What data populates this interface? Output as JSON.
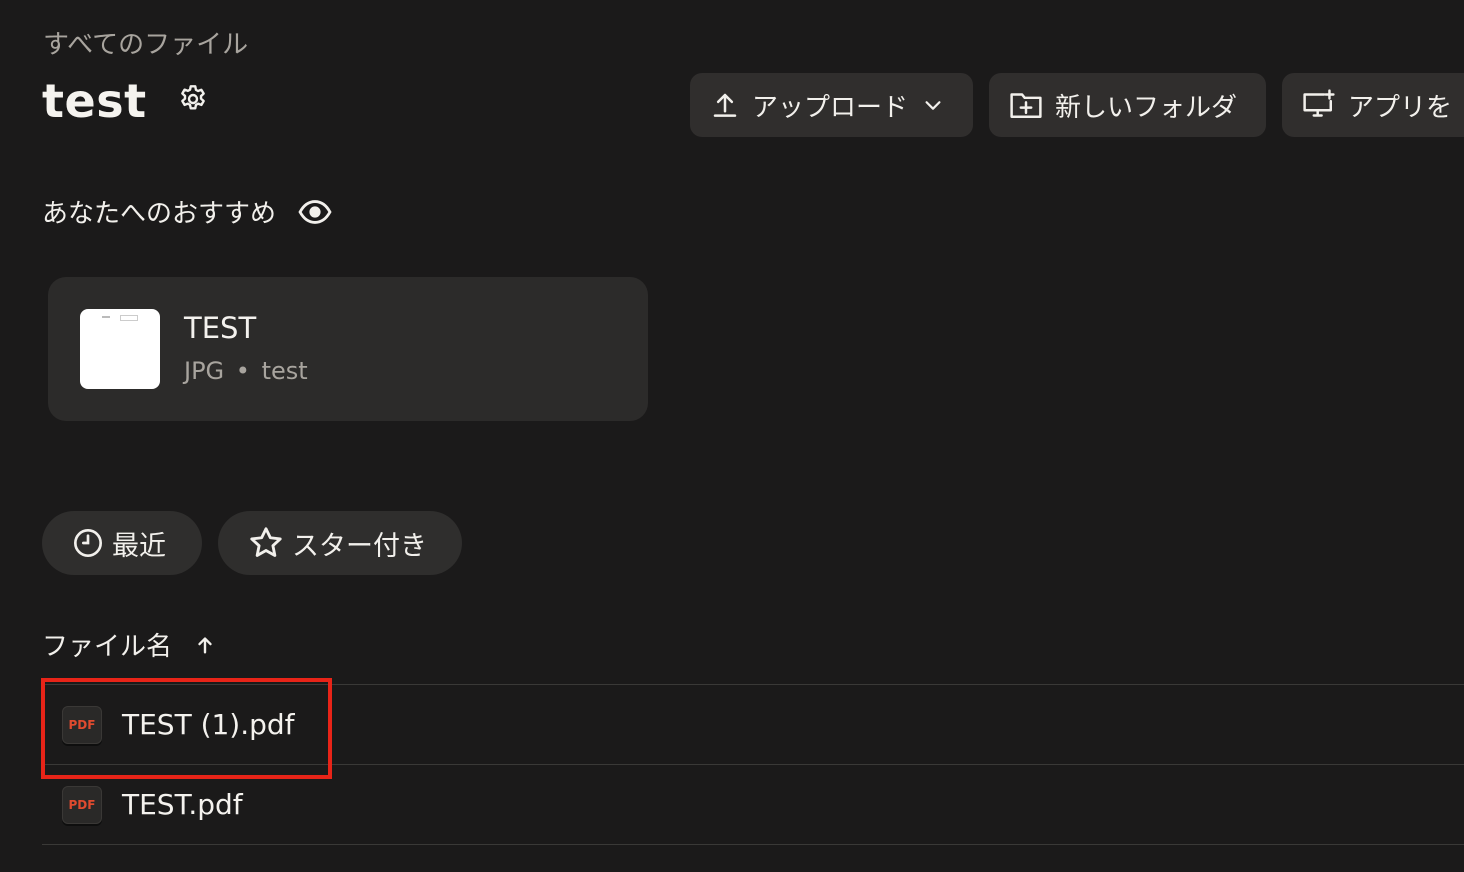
{
  "breadcrumb": "すべてのファイル",
  "header": {
    "title": "test"
  },
  "toolbar": {
    "upload_label": "アップロード",
    "new_folder_label": "新しいフォルダ",
    "app_label": "アプリを"
  },
  "suggestions": {
    "heading": "あなたへのおすすめ",
    "card": {
      "name": "TEST",
      "type": "JPG",
      "separator": "•",
      "location": "test"
    }
  },
  "filters": {
    "recent_label": "最近",
    "starred_label": "スター付き"
  },
  "file_list": {
    "column_header": "ファイル名",
    "sort": "ascending",
    "files": [
      {
        "name": "TEST (1).pdf",
        "icon_text": "PDF",
        "highlighted": true
      },
      {
        "name": "TEST.pdf",
        "icon_text": "PDF",
        "highlighted": false
      }
    ]
  },
  "colors": {
    "background": "#1b1a1a",
    "button": "#302e2d",
    "pdf_icon_text": "#e04b2f",
    "highlight": "#e82418"
  }
}
